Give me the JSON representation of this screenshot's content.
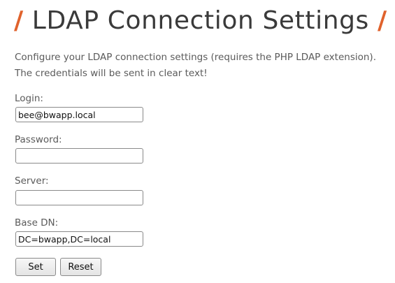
{
  "header": {
    "slash_left": "/",
    "title": "LDAP Connection Settings",
    "slash_right": "/"
  },
  "intro": {
    "line1": "Configure your LDAP connection settings (requires the PHP LDAP extension).",
    "line2": "The credentials will be sent in clear text!"
  },
  "form": {
    "login": {
      "label": "Login:",
      "value": "bee@bwapp.local"
    },
    "password": {
      "label": "Password:",
      "value": ""
    },
    "server": {
      "label": "Server:",
      "value": ""
    },
    "base_dn": {
      "label": "Base DN:",
      "value": "DC=bwapp,DC=local"
    },
    "set_label": "Set",
    "reset_label": "Reset"
  },
  "colors": {
    "accent": "#e0622c",
    "title": "#3a3a3a",
    "text": "#5a5a5a"
  }
}
